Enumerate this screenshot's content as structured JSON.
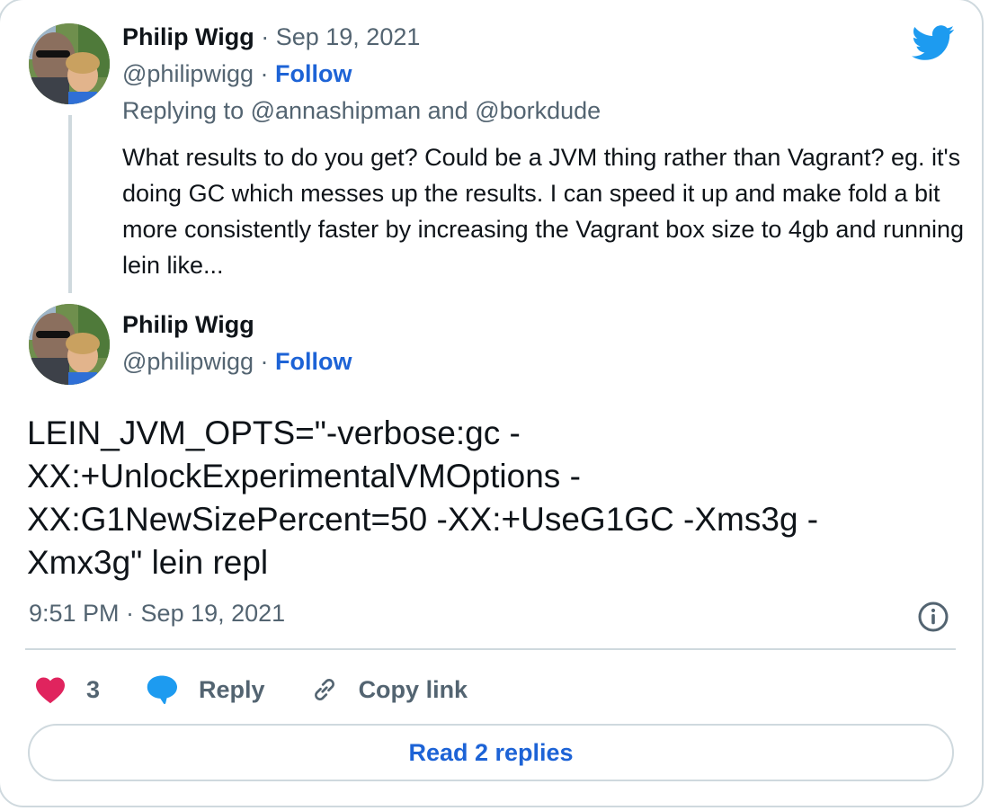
{
  "brand": {
    "logo_icon": "twitter-bird-icon",
    "accent": "#1d9bf0",
    "link_color": "#1d63d6"
  },
  "parent_tweet": {
    "author_name": "Philip Wigg",
    "date_sep": " · ",
    "date": "Sep 19, 2021",
    "handle": "@philipwigg",
    "follow_sep": " · ",
    "follow_label": "Follow",
    "replying_prefix": "Replying to ",
    "replying_to_1": "@annashipman",
    "replying_and": " and ",
    "replying_to_2": "@borkdude",
    "text": "What results to do you get? Could be a JVM thing rather than Vagrant? eg. it's doing GC which messes up the results. I can speed it up and make fold a bit more consistently faster by increasing the Vagrant box size to 4gb and running lein like..."
  },
  "main_tweet": {
    "author_name": "Philip Wigg",
    "handle": "@philipwigg",
    "follow_sep": " · ",
    "follow_label": "Follow",
    "text_lines": [
      "LEIN_JVM_OPTS=\"-verbose:gc -",
      "XX:+UnlockExperimentalVMOptions -",
      "XX:G1NewSizePercent=50 -XX:+UseG1GC -Xms3g -",
      "Xmx3g\" lein repl"
    ],
    "timestamp": "9:51 PM · Sep 19, 2021",
    "info_icon": "info-icon"
  },
  "actions": {
    "like_count": "3",
    "reply_label": "Reply",
    "copy_link_label": "Copy link",
    "like_color": "#e0245e",
    "reply_color": "#1d9bf0"
  },
  "read_replies_label": "Read 2 replies"
}
